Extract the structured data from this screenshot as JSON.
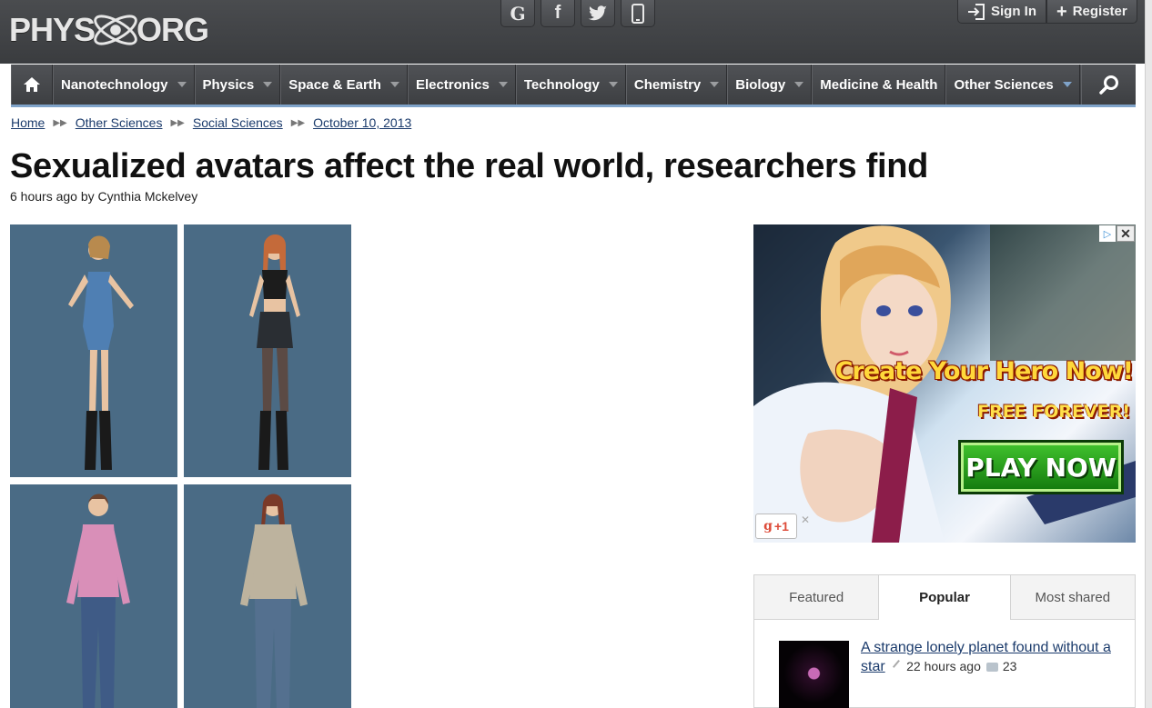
{
  "header": {
    "logo_left": "PHYS",
    "logo_right": "ORG",
    "social": [
      {
        "icon": "google-plus-icon",
        "glyph": "G"
      },
      {
        "icon": "facebook-icon",
        "glyph": "f"
      },
      {
        "icon": "twitter-icon",
        "glyph": ""
      },
      {
        "icon": "mobile-icon",
        "glyph": ""
      }
    ],
    "sign_in_label": "Sign In",
    "register_label": "Register"
  },
  "nav": {
    "items": [
      {
        "label": "Nanotechnology"
      },
      {
        "label": "Physics"
      },
      {
        "label": "Space & Earth"
      },
      {
        "label": "Electronics"
      },
      {
        "label": "Technology"
      },
      {
        "label": "Chemistry"
      },
      {
        "label": "Biology"
      },
      {
        "label": "Medicine & Health"
      },
      {
        "label": "Other Sciences"
      }
    ],
    "accent": "#7fa3c9"
  },
  "breadcrumb": [
    "Home",
    "Other Sciences",
    "Social Sciences",
    "October 10, 2013"
  ],
  "article": {
    "title": "Sexualized avatars affect the real world, researchers find",
    "byline": "6 hours ago by Cynthia Mckelvey"
  },
  "ad": {
    "headline": "Create Your Hero Now!",
    "subline": "FREE FOREVER!",
    "cta": "PLAY NOW",
    "gplus": "+1"
  },
  "widget": {
    "tabs": [
      "Featured",
      "Popular",
      "Most shared"
    ],
    "story": {
      "title": "A strange lonely planet found without a star",
      "time": "22 hours ago",
      "comments": "23"
    }
  }
}
